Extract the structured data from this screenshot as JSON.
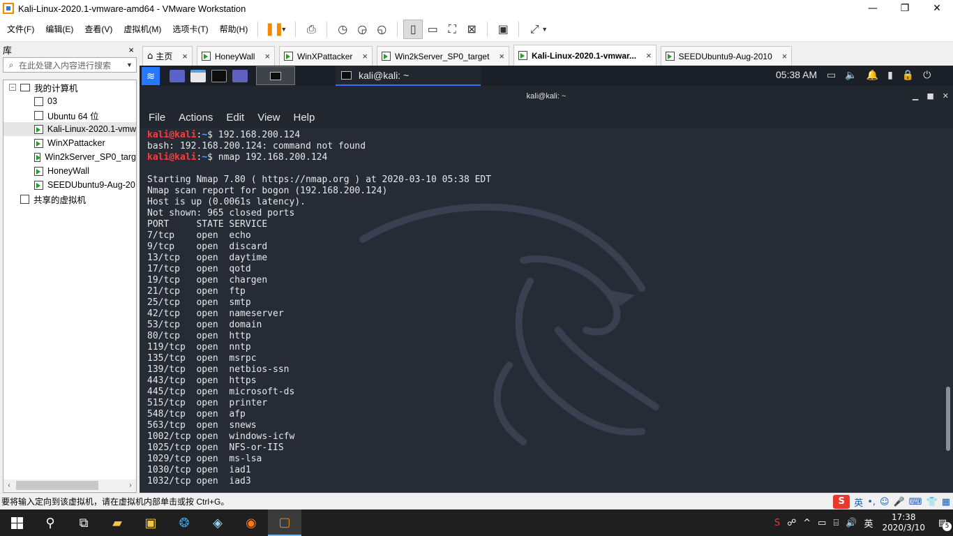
{
  "window": {
    "title": "Kali-Linux-2020.1-vmware-amd64 - VMware Workstation",
    "buttons": [
      "—",
      "❐",
      "✕"
    ]
  },
  "menubar": {
    "items": [
      "文件(F)",
      "编辑(E)",
      "查看(V)",
      "虚拟机(M)",
      "选项卡(T)",
      "帮助(H)"
    ]
  },
  "library": {
    "title": "库",
    "close": "×",
    "search_placeholder": "在此处键入内容进行搜索",
    "root": "我的计算机",
    "items": [
      "03",
      "Ubuntu 64 位",
      "Kali-Linux-2020.1-vmw",
      "WinXPattacker",
      "Win2kServer_SP0_targ",
      "HoneyWall",
      "SEEDUbuntu9-Aug-20"
    ],
    "shared": "共享的虚拟机"
  },
  "tabs": [
    {
      "label": "主页"
    },
    {
      "label": "HoneyWall"
    },
    {
      "label": "WinXPattacker"
    },
    {
      "label": "Win2kServer_SP0_target"
    },
    {
      "label": "Kali-Linux-2020.1-vmwar..."
    },
    {
      "label": "SEEDUbuntu9-Aug-2010"
    }
  ],
  "kali_panel": {
    "window_task": "kali@kali: ~",
    "clock": "05:38 AM"
  },
  "terminal": {
    "title": "kali@kali: ~",
    "menu": [
      "File",
      "Actions",
      "Edit",
      "View",
      "Help"
    ],
    "prompt_user": "kali@kali",
    "prompt_sep": ":",
    "prompt_path": "~",
    "prompt_end": "$ ",
    "cmd1": "192.168.200.124",
    "out1": "bash: 192.168.200.124: command not found",
    "cmd2": "nmap 192.168.200.124",
    "output": [
      "Starting Nmap 7.80 ( https://nmap.org ) at 2020-03-10 05:38 EDT",
      "Nmap scan report for bogon (192.168.200.124)",
      "Host is up (0.0061s latency).",
      "Not shown: 965 closed ports",
      "PORT     STATE SERVICE",
      "7/tcp    open  echo",
      "9/tcp    open  discard",
      "13/tcp   open  daytime",
      "17/tcp   open  qotd",
      "19/tcp   open  chargen",
      "21/tcp   open  ftp",
      "25/tcp   open  smtp",
      "42/tcp   open  nameserver",
      "53/tcp   open  domain",
      "80/tcp   open  http",
      "119/tcp  open  nntp",
      "135/tcp  open  msrpc",
      "139/tcp  open  netbios-ssn",
      "443/tcp  open  https",
      "445/tcp  open  microsoft-ds",
      "515/tcp  open  printer",
      "548/tcp  open  afp",
      "563/tcp  open  snews",
      "1002/tcp open  windows-icfw",
      "1025/tcp open  NFS-or-IIS",
      "1029/tcp open  ms-lsa",
      "1030/tcp open  iad1",
      "1032/tcp open  iad3"
    ]
  },
  "statusbar": {
    "message": "要将输入定向到该虚拟机，请在虚拟机内部单击或按 Ctrl+G。",
    "ime_label": "英"
  },
  "taskbar": {
    "time": "17:38",
    "date": "2020/3/10",
    "lang": "英",
    "notifications": "5"
  }
}
